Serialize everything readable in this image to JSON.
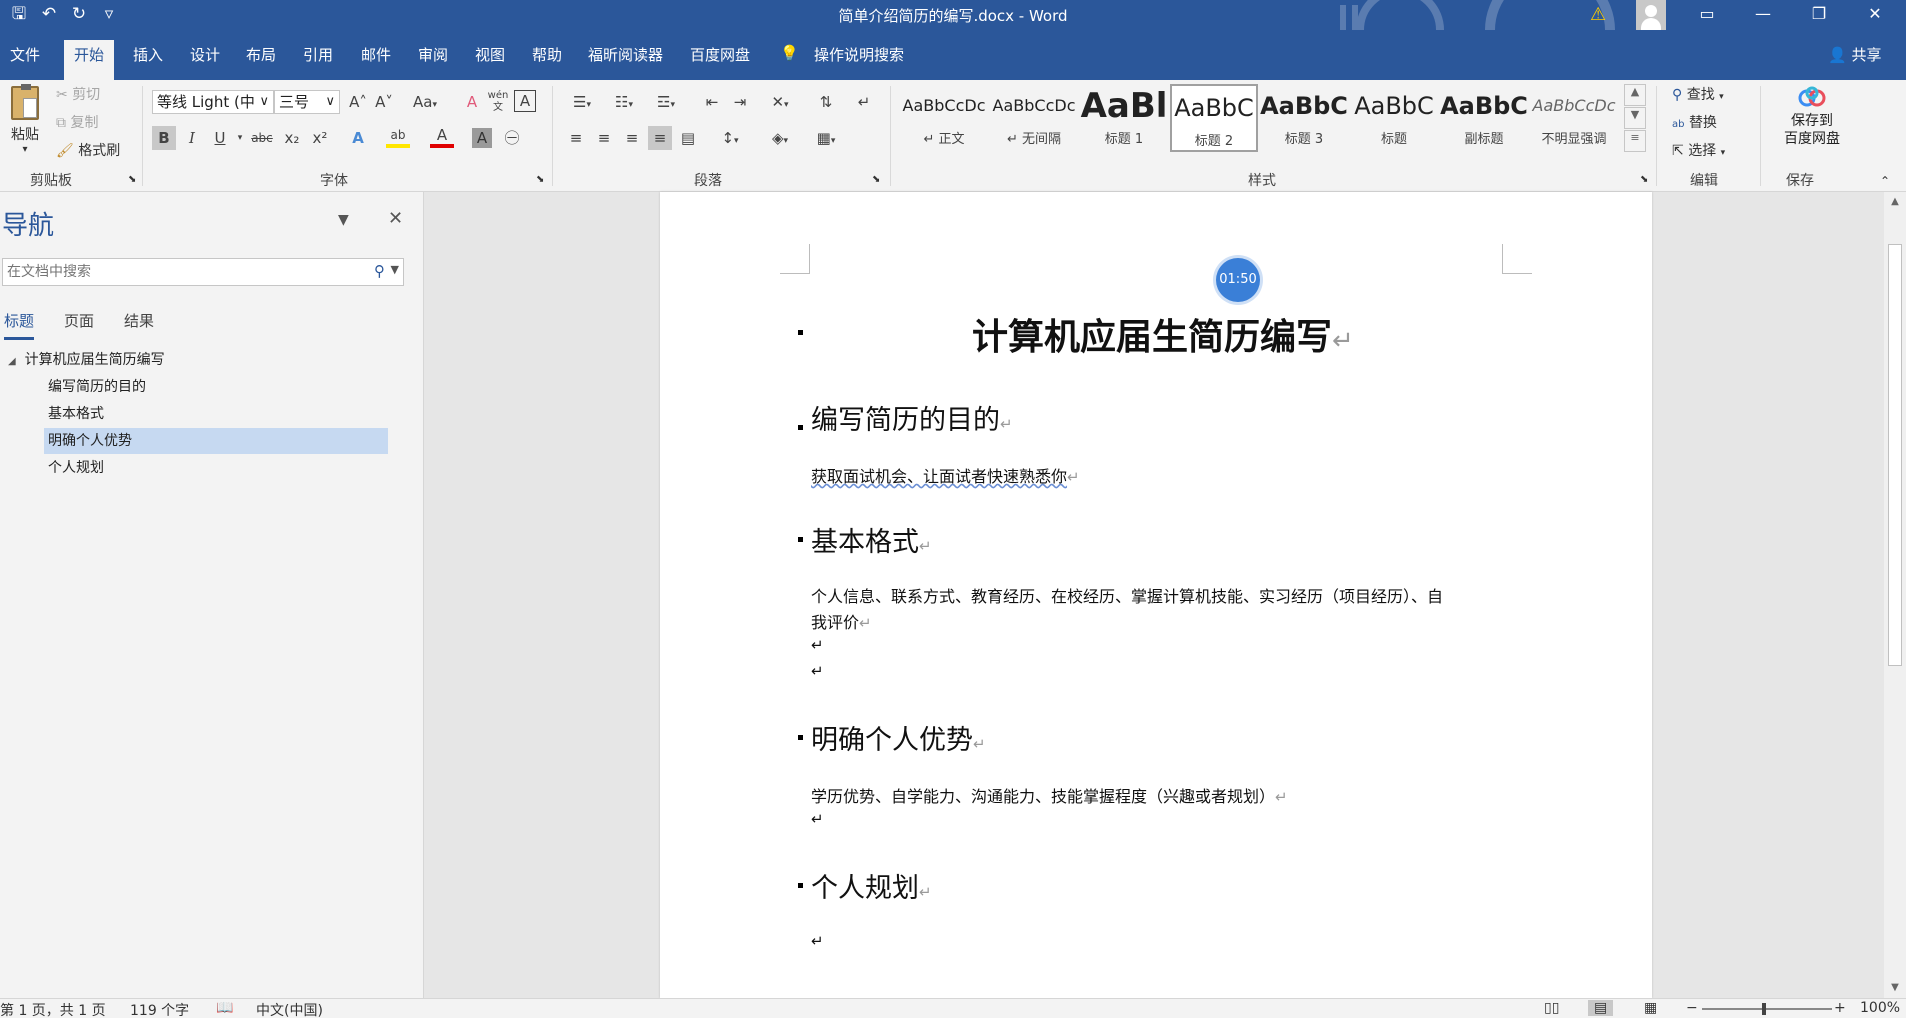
{
  "window": {
    "title": "简单介绍简历的编写.docx - Word",
    "qat": {
      "save_icon": "🖫",
      "undo_icon": "↶",
      "redo_icon": "↻",
      "customize_icon": "▿"
    },
    "warning_icon": "⚠",
    "minimize": "—",
    "restore": "❐",
    "close": "✕"
  },
  "tabs": [
    "文件",
    "开始",
    "插入",
    "设计",
    "布局",
    "引用",
    "邮件",
    "审阅",
    "视图",
    "帮助",
    "福昕阅读器",
    "百度网盘"
  ],
  "tell_me": {
    "icon": "💡",
    "label": "操作说明搜索"
  },
  "share": "共享",
  "ribbon": {
    "clipboard": {
      "label": "剪贴板",
      "paste": "粘贴",
      "cut": "剪切",
      "copy": "复制",
      "format_painter": "格式刷"
    },
    "font": {
      "label": "字体",
      "font_name": "等线 Light (中",
      "font_size": "三号",
      "grow": "A˄",
      "shrink": "A˅",
      "change_case": "Aa",
      "clear_format": "A",
      "pinyin": "wén",
      "char_border": "A",
      "bold": "B",
      "italic": "I",
      "underline": "U",
      "strike": "abc",
      "subscript": "x₂",
      "superscript": "x²",
      "text_effect": "A",
      "highlight": "ab",
      "font_color": "A",
      "char_shading": "A",
      "enclose": "㊀"
    },
    "paragraph": {
      "label": "段落"
    },
    "styles": {
      "label": "样式",
      "items": [
        {
          "preview": "AaBbCcDc",
          "name": "↵ 正文"
        },
        {
          "preview": "AaBbCcDc",
          "name": "↵ 无间隔"
        },
        {
          "preview": "AaBl",
          "name": "标题 1"
        },
        {
          "preview": "AaBbC",
          "name": "标题 2"
        },
        {
          "preview": "AaBbC",
          "name": "标题 3"
        },
        {
          "preview": "AaBbC",
          "name": "标题"
        },
        {
          "preview": "AaBbC",
          "name": "副标题"
        },
        {
          "preview": "AaBbCcDc",
          "name": "不明显强调"
        }
      ]
    },
    "editing": {
      "label": "编辑",
      "find": "查找",
      "replace": "替换",
      "select": "选择"
    },
    "save": {
      "label": "保存",
      "button": "保存到\n百度网盘"
    }
  },
  "nav": {
    "title": "导航",
    "search_placeholder": "在文档中搜索",
    "tabs": [
      "标题",
      "页面",
      "结果"
    ],
    "tree": [
      {
        "label": "计算机应届生简历编写",
        "level": 0
      },
      {
        "label": "编写简历的目的",
        "level": 1
      },
      {
        "label": "基本格式",
        "level": 1
      },
      {
        "label": "明确个人优势",
        "level": 1,
        "selected": true
      },
      {
        "label": "个人规划",
        "level": 1
      }
    ]
  },
  "timer": "01:50",
  "document": {
    "title": "计算机应届生简历编写",
    "sections": [
      {
        "heading": "编写简历的目的",
        "body": "获取面试机会、让面试者快速熟悉你"
      },
      {
        "heading": "基本格式",
        "body_line1": "个人信息、联系方式、教育经历、在校经历、掌握计算机技能、实习经历（项目经历）、自",
        "body_line2": "我评价"
      },
      {
        "heading": "明确个人优势",
        "body": "学历优势、自学能力、沟通能力、技能掌握程度（兴趣或者规划）"
      },
      {
        "heading": "个人规划"
      }
    ],
    "para_mark": "↵"
  },
  "status": {
    "page": "第 1 页，共 1 页",
    "words": "119 个字",
    "language": "中文(中国)",
    "zoom": "100%"
  },
  "colors": {
    "accent": "#2b579a",
    "selected_nav": "#c6d9f1",
    "timer": "#3a7fd7"
  }
}
